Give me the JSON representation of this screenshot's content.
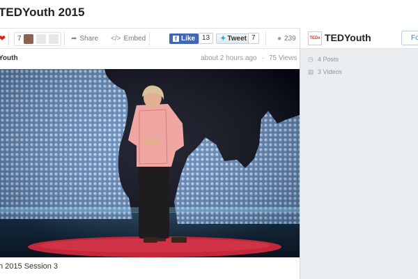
{
  "page": {
    "title": "TEDYouth 2015"
  },
  "toolbar": {
    "like_count": "7",
    "share_label": "Share",
    "embed_label": "Embed",
    "fb_like_label": "Like",
    "fb_like_count": "13",
    "tweet_label": "Tweet",
    "tweet_count": "7",
    "views": "239"
  },
  "video": {
    "channel": "Youth",
    "posted": "about 2 hours ago",
    "views": "75 Views",
    "caption": "h 2015 Session 3"
  },
  "sidebar": {
    "logo_text": "TEDx",
    "channel_name": "TEDYouth",
    "follow_label": "Fo",
    "posts": "4 Posts",
    "videos": "3 Videos"
  },
  "colors": {
    "facebook": "#4267b2",
    "twitter": "#2aa3ef",
    "ted_red": "#e62b1e",
    "heart": "#d9241c",
    "sidebar_bg": "#ebeef1"
  }
}
